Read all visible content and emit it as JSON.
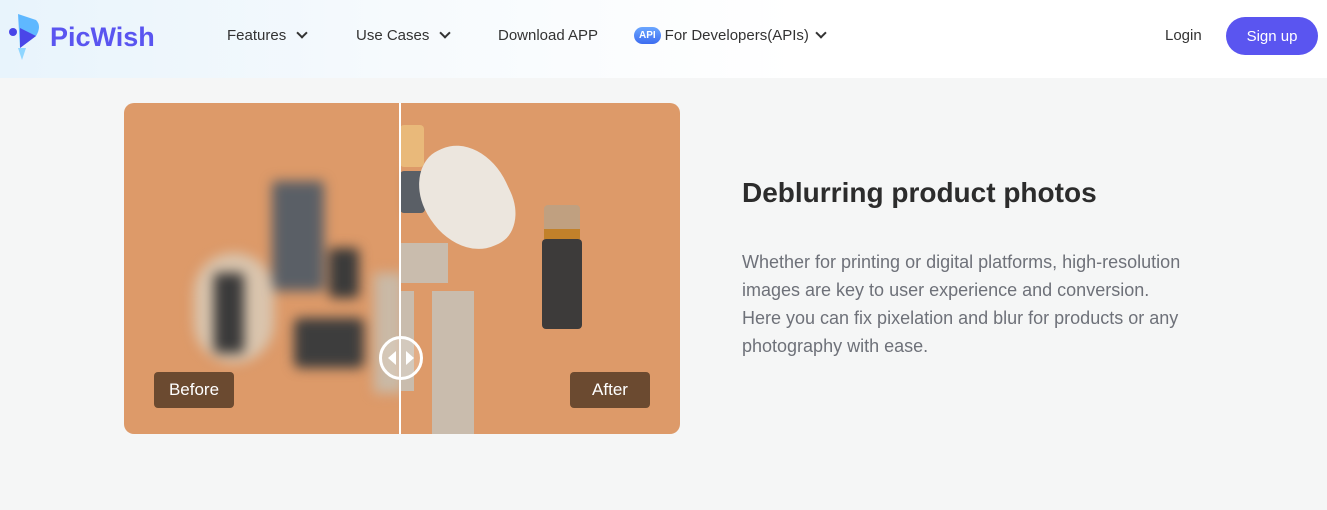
{
  "header": {
    "brand": "PicWish",
    "nav": [
      {
        "label": "Features",
        "has_dropdown": true
      },
      {
        "label": "Use Cases",
        "has_dropdown": true
      },
      {
        "label": "Download APP",
        "has_dropdown": false
      },
      {
        "label": "For Developers(APIs)",
        "has_dropdown": true,
        "badge": "API"
      }
    ],
    "login": "Login",
    "signup": "Sign up",
    "accent_color": "#5a55f0"
  },
  "comparison": {
    "before_label": "Before",
    "after_label": "After",
    "slider_position_percent": 50
  },
  "feature": {
    "title": "Deblurring product photos",
    "description": "Whether for printing or digital platforms, high-resolution images are key to user experience and conversion. Here you can fix pixelation and blur for products or any photography with ease."
  }
}
